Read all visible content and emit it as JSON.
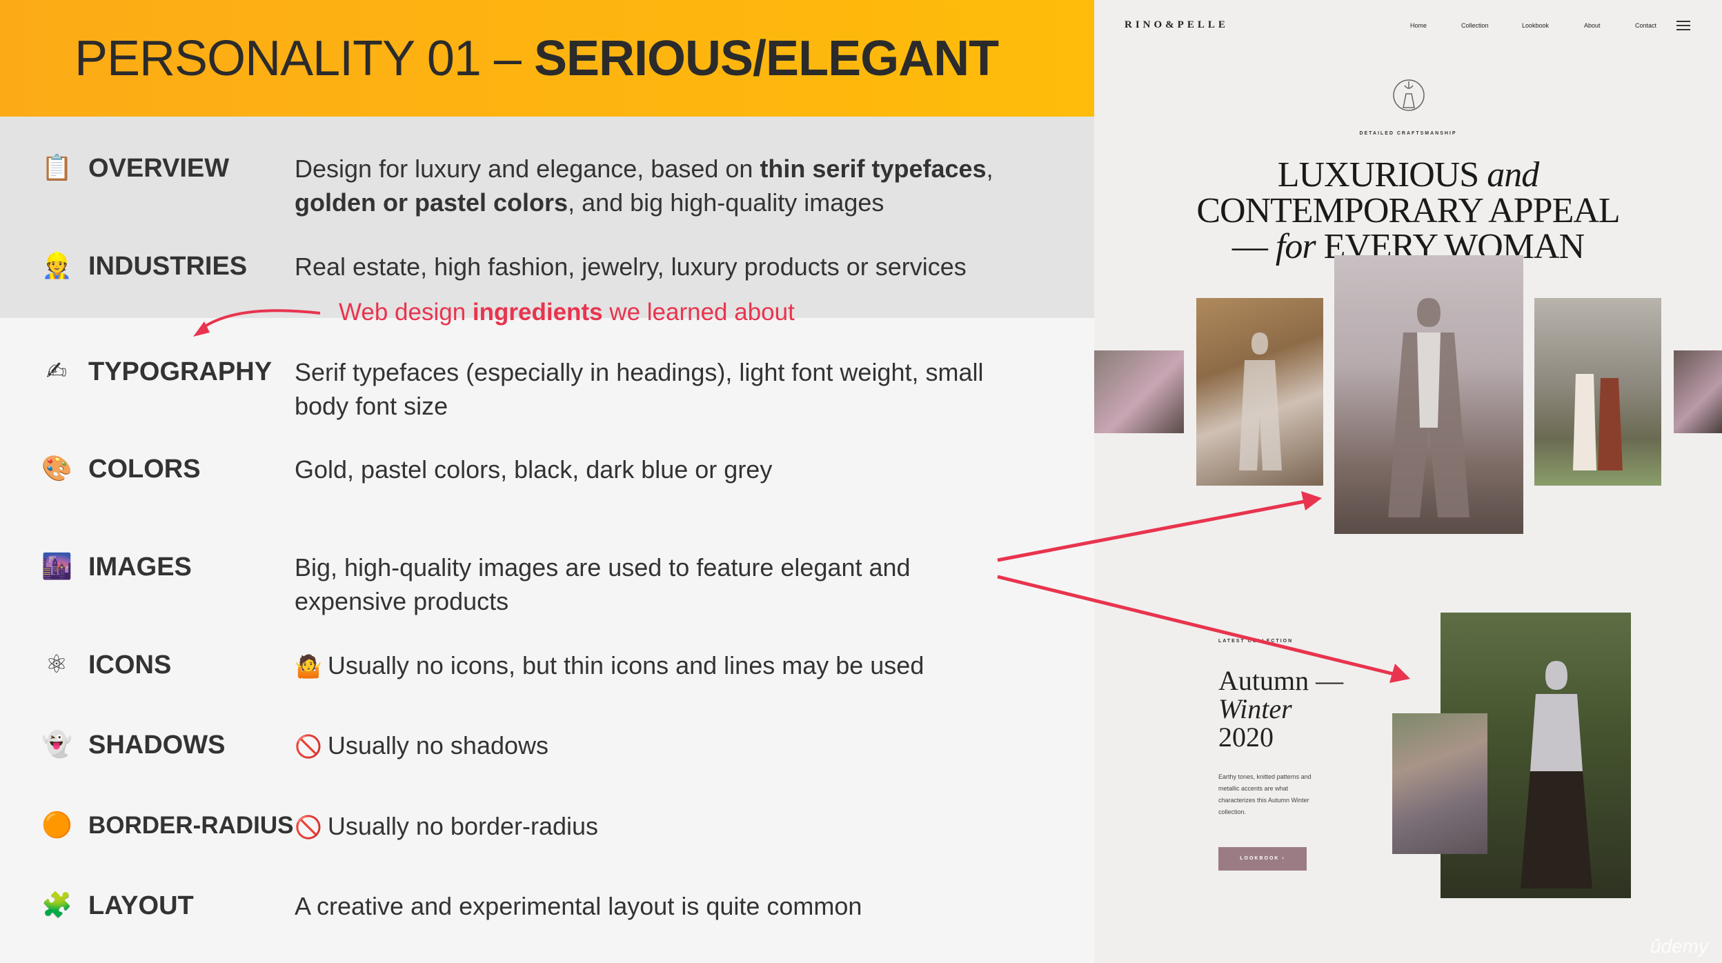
{
  "slide": {
    "title_regular": "PERSONALITY 01 – ",
    "title_bold": "SERIOUS/ELEGANT",
    "annotation": {
      "prefix": "Web design ",
      "bold": "ingredients",
      "suffix": " we learned about"
    },
    "rows": [
      {
        "icon": "📋",
        "label": "OVERVIEW",
        "desc_html_parts": [
          "Design for luxury and elegance, based on ",
          "thin serif typefaces",
          ", ",
          "golden or pastel colors",
          ", and big high-quality images"
        ]
      },
      {
        "icon": "👷",
        "label": "INDUSTRIES",
        "desc": "Real estate, high fashion, jewelry, luxury products or services"
      },
      {
        "icon": "✍",
        "label": "TYPOGRAPHY",
        "desc": "Serif typefaces (especially in headings), light font weight, small body font size"
      },
      {
        "icon": "🎨",
        "label": "COLORS",
        "desc": "Gold, pastel colors, black, dark blue or grey"
      },
      {
        "icon": "🌆",
        "label": "IMAGES",
        "desc": "Big, high-quality images are used to feature elegant and expensive products"
      },
      {
        "icon": "⚛",
        "label": "ICONS",
        "pre": "🤷",
        "desc": "Usually no icons, but thin icons and lines may be used"
      },
      {
        "icon": "👻",
        "label": "SHADOWS",
        "pre": "🚫",
        "desc": "Usually no shadows"
      },
      {
        "icon": "🟠",
        "label": "BORDER-RADIUS",
        "pre": "🚫",
        "desc": "Usually no border-radius"
      },
      {
        "icon": "🧩",
        "label": "LAYOUT",
        "desc": "A creative and experimental layout is quite common"
      }
    ]
  },
  "site": {
    "logo": "RINO&PELLE",
    "nav": [
      "Home",
      "Collection",
      "Lookbook",
      "About",
      "Contact"
    ],
    "tagline": "DETAILED CRAFTSMANSHIP",
    "headline": {
      "l1a": "LUXURIOUS ",
      "l1b": "and",
      "l2": "CONTEMPORARY APPEAL",
      "l3a": "— ",
      "l3b": "for",
      "l3c": " EVERY WOMAN"
    },
    "latest": "LATEST COLLECTION",
    "season": {
      "l1": "Autumn —",
      "l2": "Winter",
      "l3": "2020"
    },
    "season_body": "Earthy tones, knitted patterns and metallic accents are what characterizes this Autumn Winter collection.",
    "button": "LOOKBOOK  ›"
  },
  "watermark": "ûdemy",
  "colors": {
    "title_bar": "#fcab16",
    "annotation": "#e8344e",
    "button": "#9b7c84"
  }
}
